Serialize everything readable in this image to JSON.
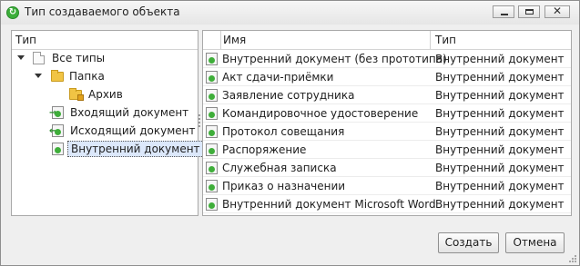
{
  "window": {
    "title": "Тип создаваемого объекта"
  },
  "tree": {
    "header": "Тип",
    "items": [
      {
        "label": "Все типы"
      },
      {
        "label": "Папка"
      },
      {
        "label": "Архив"
      },
      {
        "label": "Входящий документ"
      },
      {
        "label": "Исходящий документ"
      },
      {
        "label": "Внутренний документ"
      }
    ]
  },
  "list": {
    "columns": {
      "name": "Имя",
      "type": "Тип"
    },
    "rows": [
      {
        "name": "Внутренний документ (без прототипа)",
        "type": "Внутренний документ"
      },
      {
        "name": "Акт сдачи-приёмки",
        "type": "Внутренний документ"
      },
      {
        "name": "Заявление сотрудника",
        "type": "Внутренний документ"
      },
      {
        "name": "Командировочное удостоверение",
        "type": "Внутренний документ"
      },
      {
        "name": "Протокол совещания",
        "type": "Внутренний документ"
      },
      {
        "name": "Распоряжение",
        "type": "Внутренний документ"
      },
      {
        "name": "Служебная записка",
        "type": "Внутренний документ"
      },
      {
        "name": "Приказ о назначении",
        "type": "Внутренний документ"
      },
      {
        "name": "Внутренний документ Microsoft Word",
        "type": "Внутренний документ"
      }
    ]
  },
  "buttons": {
    "create": "Создать",
    "cancel": "Отмена"
  },
  "colors": {
    "selection": "#dce8fb",
    "accent": "#3fae3a",
    "folder": "#f1c444"
  }
}
